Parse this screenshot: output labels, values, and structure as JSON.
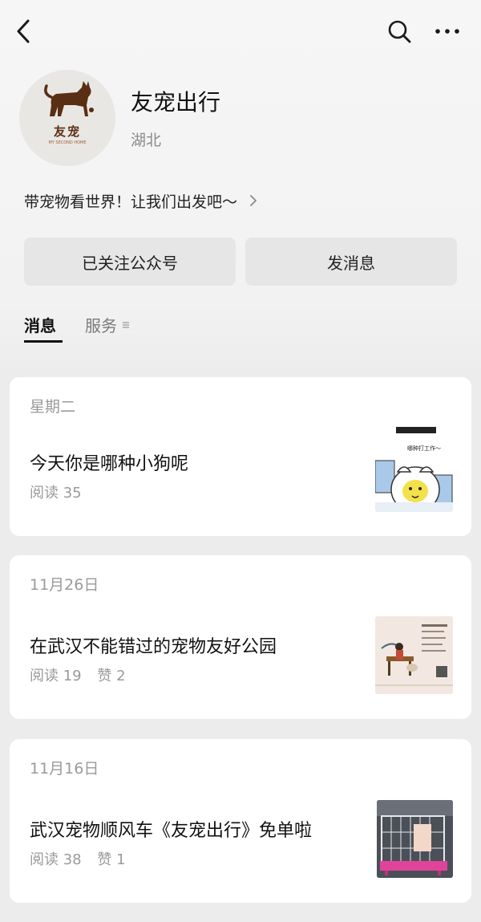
{
  "header": {
    "back_icon": "back-arrow-icon",
    "search_icon": "search-icon",
    "more_icon": "more-dots-icon"
  },
  "account": {
    "name": "友宠出行",
    "region": "湖北",
    "avatar_text": "友宠",
    "avatar_subtext": "MY SECOND HOME",
    "bio": "带宠物看世界！让我们出发吧～"
  },
  "actions": {
    "follow_label": "已关注公众号",
    "message_label": "发消息"
  },
  "tabs": [
    {
      "label": "消息",
      "active": true
    },
    {
      "label": "服务",
      "active": false
    }
  ],
  "articles": [
    {
      "date": "星期二",
      "title": "今天你是哪种小狗呢",
      "reads": "阅读 35",
      "likes": "",
      "thumb_caption": "哪种打工作～"
    },
    {
      "date": "11月26日",
      "title": "在武汉不能错过的宠物友好公园",
      "reads": "阅读 19",
      "likes": "赞 2"
    },
    {
      "date": "11月16日",
      "title": "武汉宠物顺风车《友宠出行》免单啦",
      "reads": "阅读 38",
      "likes": "赞 1"
    }
  ],
  "colors": {
    "background": "#ececec",
    "card": "#ffffff",
    "button": "#e6e6e6",
    "muted_text": "#9a9a9a",
    "avatar_brown": "#5a2e14"
  }
}
